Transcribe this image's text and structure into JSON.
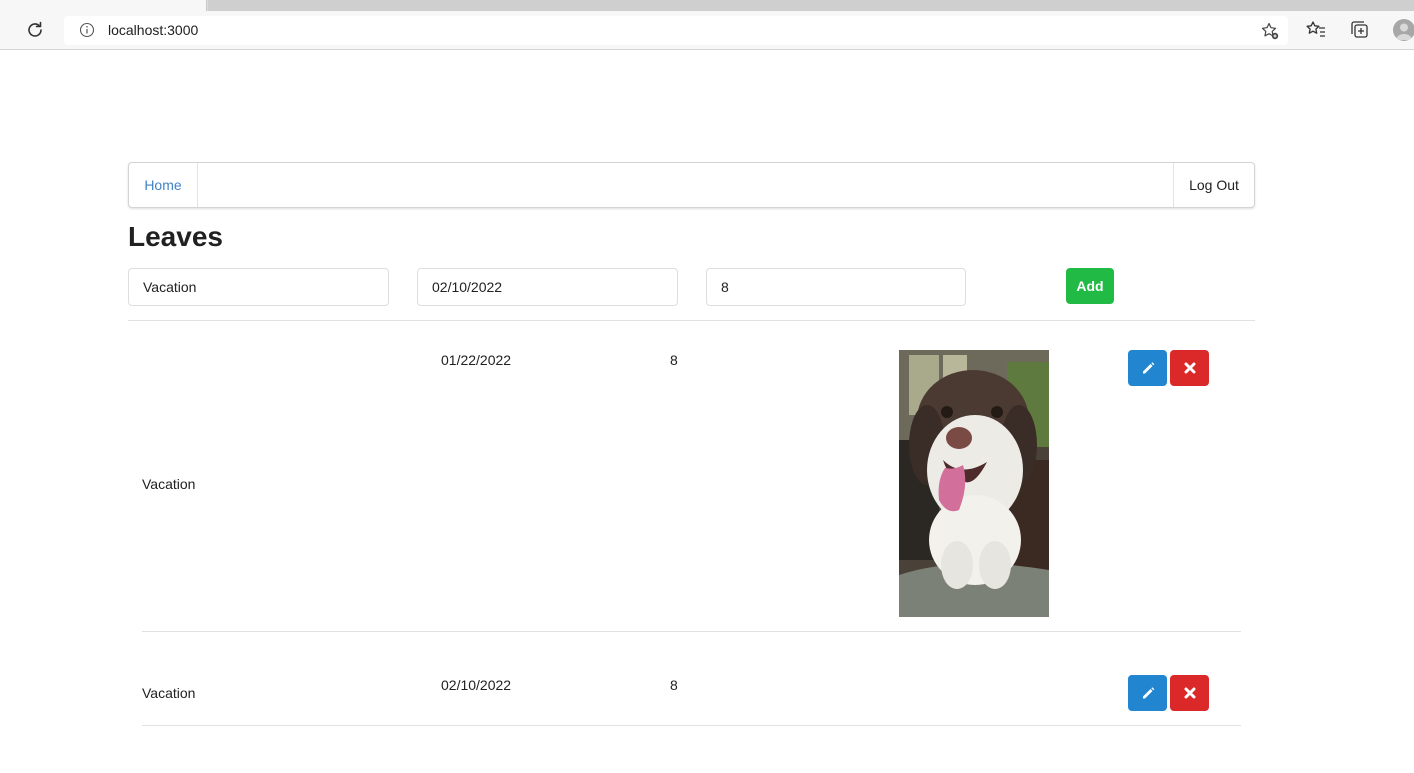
{
  "browser": {
    "url": "localhost:3000"
  },
  "nav": {
    "home_label": "Home",
    "logout_label": "Log Out"
  },
  "page": {
    "title": "Leaves"
  },
  "form": {
    "type_value": "Vacation",
    "date_value": "02/10/2022",
    "hours_value": "8",
    "add_label": "Add"
  },
  "leaves": [
    {
      "type": "Vacation",
      "date": "01/22/2022",
      "hours": "8",
      "has_photo": true,
      "photo": "dog-photo"
    },
    {
      "type": "Vacation",
      "date": "02/10/2022",
      "hours": "8",
      "has_photo": false
    }
  ],
  "colors": {
    "link": "#4183c4",
    "add": "#21ba45",
    "edit": "#2185d0",
    "delete": "#db2828"
  },
  "icons": {
    "edit": "pencil-icon",
    "delete": "x-icon"
  }
}
